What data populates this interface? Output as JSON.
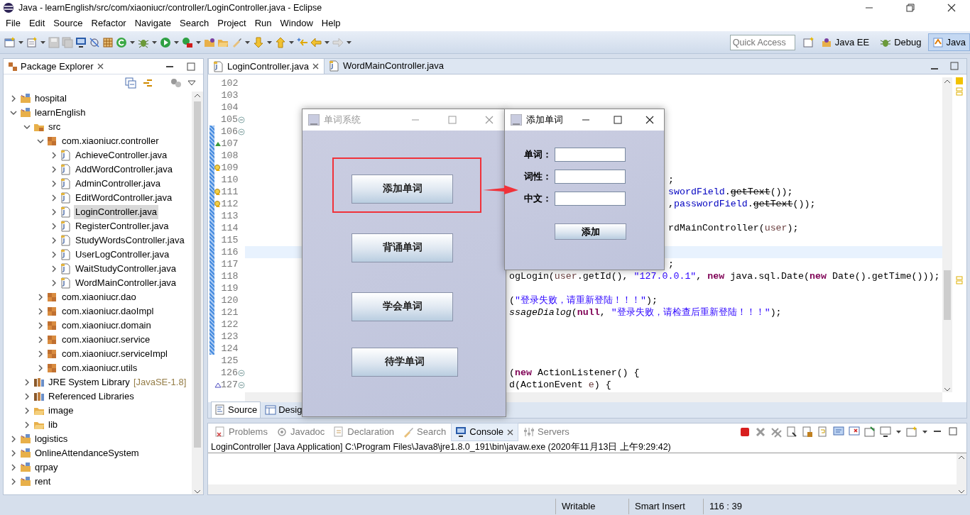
{
  "window": {
    "title": "Java - learnEnglish/src/com/xiaoniucr/controller/LoginController.java - Eclipse"
  },
  "menu": [
    "File",
    "Edit",
    "Source",
    "Refactor",
    "Navigate",
    "Search",
    "Project",
    "Run",
    "Window",
    "Help"
  ],
  "quick_access": {
    "placeholder": "Quick Access"
  },
  "perspectives": [
    {
      "label": "Java EE",
      "selected": false
    },
    {
      "label": "Debug",
      "selected": false
    },
    {
      "label": "Java",
      "selected": true
    }
  ],
  "package_explorer": {
    "title": "Package Explorer",
    "tree": [
      {
        "label": "hospital",
        "kind": "project",
        "expanded": false,
        "selected": false
      },
      {
        "label": "learnEnglish",
        "kind": "project",
        "expanded": true,
        "selected": false,
        "children": [
          {
            "label": "src",
            "kind": "source-folder",
            "expanded": true,
            "selected": false,
            "children": [
              {
                "label": "com.xiaoniucr.controller",
                "kind": "package",
                "expanded": true,
                "selected": false,
                "children": [
                  {
                    "label": "AchieveController.java",
                    "kind": "java-file",
                    "expanded": false,
                    "selected": false
                  },
                  {
                    "label": "AddWordController.java",
                    "kind": "java-file",
                    "expanded": false,
                    "selected": false
                  },
                  {
                    "label": "AdminController.java",
                    "kind": "java-file",
                    "expanded": false,
                    "selected": false
                  },
                  {
                    "label": "EditWordController.java",
                    "kind": "java-file",
                    "expanded": false,
                    "selected": false
                  },
                  {
                    "label": "LoginController.java",
                    "kind": "java-file",
                    "expanded": false,
                    "selected": true
                  },
                  {
                    "label": "RegisterController.java",
                    "kind": "java-file",
                    "expanded": false,
                    "selected": false
                  },
                  {
                    "label": "StudyWordsController.java",
                    "kind": "java-file",
                    "expanded": false,
                    "selected": false
                  },
                  {
                    "label": "UserLogController.java",
                    "kind": "java-file",
                    "expanded": false,
                    "selected": false
                  },
                  {
                    "label": "WaitStudyController.java",
                    "kind": "java-file",
                    "expanded": false,
                    "selected": false
                  },
                  {
                    "label": "WordMainController.java",
                    "kind": "java-file",
                    "expanded": false,
                    "selected": false
                  }
                ]
              },
              {
                "label": "com.xiaoniucr.dao",
                "kind": "package",
                "expanded": false,
                "selected": false
              },
              {
                "label": "com.xiaoniucr.daoImpl",
                "kind": "package",
                "expanded": false,
                "selected": false
              },
              {
                "label": "com.xiaoniucr.domain",
                "kind": "package",
                "expanded": false,
                "selected": false
              },
              {
                "label": "com.xiaoniucr.service",
                "kind": "package",
                "expanded": false,
                "selected": false
              },
              {
                "label": "com.xiaoniucr.serviceImpl",
                "kind": "package",
                "expanded": false,
                "selected": false
              },
              {
                "label": "com.xiaoniucr.utils",
                "kind": "package",
                "expanded": false,
                "selected": false
              }
            ]
          },
          {
            "label": "JRE System Library",
            "decoration": "[JavaSE-1.8]",
            "kind": "library",
            "expanded": false,
            "selected": false
          },
          {
            "label": "Referenced Libraries",
            "kind": "library",
            "expanded": false,
            "selected": false
          },
          {
            "label": "image",
            "kind": "folder",
            "expanded": false,
            "selected": false
          },
          {
            "label": "lib",
            "kind": "folder",
            "expanded": false,
            "selected": false
          }
        ]
      },
      {
        "label": "logistics",
        "kind": "project",
        "expanded": false,
        "selected": false
      },
      {
        "label": "OnlineAttendanceSystem",
        "kind": "project",
        "expanded": false,
        "selected": false
      },
      {
        "label": "qrpay",
        "kind": "project",
        "expanded": false,
        "selected": false
      },
      {
        "label": "rent",
        "kind": "project",
        "expanded": false,
        "selected": false
      }
    ]
  },
  "editor_tabs": [
    {
      "label": "LoginController.java",
      "selected": true
    },
    {
      "label": "WordMainController.java",
      "selected": false
    }
  ],
  "code_lines": [
    {
      "number": "102",
      "changed": false,
      "current": false
    },
    {
      "number": "103",
      "changed": false,
      "current": false
    },
    {
      "number": "104",
      "changed": false,
      "current": false
    },
    {
      "number": "105",
      "changed": false,
      "current": false,
      "foldable": true
    },
    {
      "number": "106",
      "changed": true,
      "current": false,
      "foldable": true
    },
    {
      "number": "107",
      "changed": true,
      "current": false,
      "override": true
    },
    {
      "number": "108",
      "changed": true,
      "current": false
    },
    {
      "number": "109",
      "changed": true,
      "current": false,
      "warning": true
    },
    {
      "number": "110",
      "changed": true,
      "current": false,
      "segments": [
        {
          "kind": "plain",
          "text": ";"
        }
      ]
    },
    {
      "number": "111",
      "changed": true,
      "current": false,
      "warning": true,
      "segments": [
        {
          "kind": "field",
          "text": "swordField"
        },
        {
          "kind": "plain",
          "text": "."
        },
        {
          "kind": "deprecated",
          "text": "getText"
        },
        {
          "kind": "plain",
          "text": "());"
        }
      ]
    },
    {
      "number": "112",
      "changed": true,
      "current": false,
      "warning": true,
      "segments": [
        {
          "kind": "plain",
          "text": ","
        },
        {
          "kind": "field",
          "text": "passwordField"
        },
        {
          "kind": "plain",
          "text": "."
        },
        {
          "kind": "deprecated",
          "text": "getText"
        },
        {
          "kind": "plain",
          "text": "());"
        }
      ]
    },
    {
      "number": "113",
      "changed": true,
      "current": false
    },
    {
      "number": "114",
      "changed": true,
      "current": false,
      "segments": [
        {
          "kind": "plain",
          "text": "rdMainController("
        },
        {
          "kind": "local",
          "text": "user"
        },
        {
          "kind": "plain",
          "text": ");"
        }
      ]
    },
    {
      "number": "115",
      "changed": true,
      "current": false
    },
    {
      "number": "116",
      "changed": true,
      "current": true
    },
    {
      "number": "117",
      "changed": true,
      "current": false,
      "segments": [
        {
          "kind": "plain",
          "text": ";"
        }
      ]
    },
    {
      "number": "118",
      "changed": true,
      "current": false,
      "segments": [
        {
          "kind": "plain",
          "text": "ogLogin("
        },
        {
          "kind": "local",
          "text": "user"
        },
        {
          "kind": "plain",
          "text": ".getId(), "
        },
        {
          "kind": "string",
          "text": "\"127.0.0.1\""
        },
        {
          "kind": "plain",
          "text": ", "
        },
        {
          "kind": "keyword",
          "text": "new"
        },
        {
          "kind": "plain",
          "text": " java.sql.Date("
        },
        {
          "kind": "keyword",
          "text": "new"
        },
        {
          "kind": "plain",
          "text": " Date().getTime()));"
        }
      ]
    },
    {
      "number": "119",
      "changed": true,
      "current": false
    },
    {
      "number": "120",
      "changed": true,
      "current": false,
      "segments": [
        {
          "kind": "plain",
          "text": "("
        },
        {
          "kind": "string",
          "text": "\"登录失败，请重新登陆！！！\""
        },
        {
          "kind": "plain",
          "text": ");"
        }
      ]
    },
    {
      "number": "121",
      "changed": true,
      "current": false,
      "segments": [
        {
          "kind": "static",
          "text": "ssageDialog"
        },
        {
          "kind": "plain",
          "text": "("
        },
        {
          "kind": "keyword",
          "text": "null"
        },
        {
          "kind": "plain",
          "text": ", "
        },
        {
          "kind": "string",
          "text": "\"登录失败，请检查后重新登陆！！！\""
        },
        {
          "kind": "plain",
          "text": ");"
        }
      ]
    },
    {
      "number": "122",
      "changed": true,
      "current": false
    },
    {
      "number": "123",
      "changed": true,
      "current": false
    },
    {
      "number": "124",
      "changed": true,
      "current": false
    },
    {
      "number": "125",
      "changed": false,
      "current": false
    },
    {
      "number": "126",
      "changed": false,
      "current": false,
      "foldable": true,
      "segments": [
        {
          "kind": "plain",
          "text": "("
        },
        {
          "kind": "keyword",
          "text": "new"
        },
        {
          "kind": "plain",
          "text": " ActionListener() {"
        }
      ]
    },
    {
      "number": "127",
      "changed": false,
      "current": false,
      "implements": true,
      "foldable": true,
      "segments": [
        {
          "kind": "plain",
          "text": "d(ActionEvent "
        },
        {
          "kind": "local",
          "text": "e"
        },
        {
          "kind": "plain",
          "text": ") {"
        }
      ]
    }
  ],
  "editor_bottom_tabs": [
    {
      "label": "Source",
      "selected": true
    },
    {
      "label": "Desig",
      "selected": false
    }
  ],
  "console_tabs": [
    {
      "label": "Problems",
      "selected": false
    },
    {
      "label": "Javadoc",
      "selected": false
    },
    {
      "label": "Declaration",
      "selected": false
    },
    {
      "label": "Search",
      "selected": false
    },
    {
      "label": "Console",
      "selected": true
    },
    {
      "label": "Servers",
      "selected": false
    }
  ],
  "console": {
    "header": "LoginController [Java Application] C:\\Program Files\\Java8\\jre1.8.0_191\\bin\\javaw.exe (2020年11月13日 上午9:29:42)"
  },
  "status_bar": [
    "Writable",
    "Smart Insert",
    "116 : 39"
  ],
  "main_dialog": {
    "title": "单词系统",
    "active": false,
    "buttons": [
      {
        "label": "添加单词",
        "highlighted": true
      },
      {
        "label": "背诵单词",
        "highlighted": false
      },
      {
        "label": "学会单词",
        "highlighted": false
      },
      {
        "label": "待学单词",
        "highlighted": false
      }
    ]
  },
  "add_dialog": {
    "title": "添加单词",
    "active": true,
    "fields": [
      {
        "label": "单词："
      },
      {
        "label": "词性："
      },
      {
        "label": "中文："
      }
    ],
    "button": "添加"
  }
}
